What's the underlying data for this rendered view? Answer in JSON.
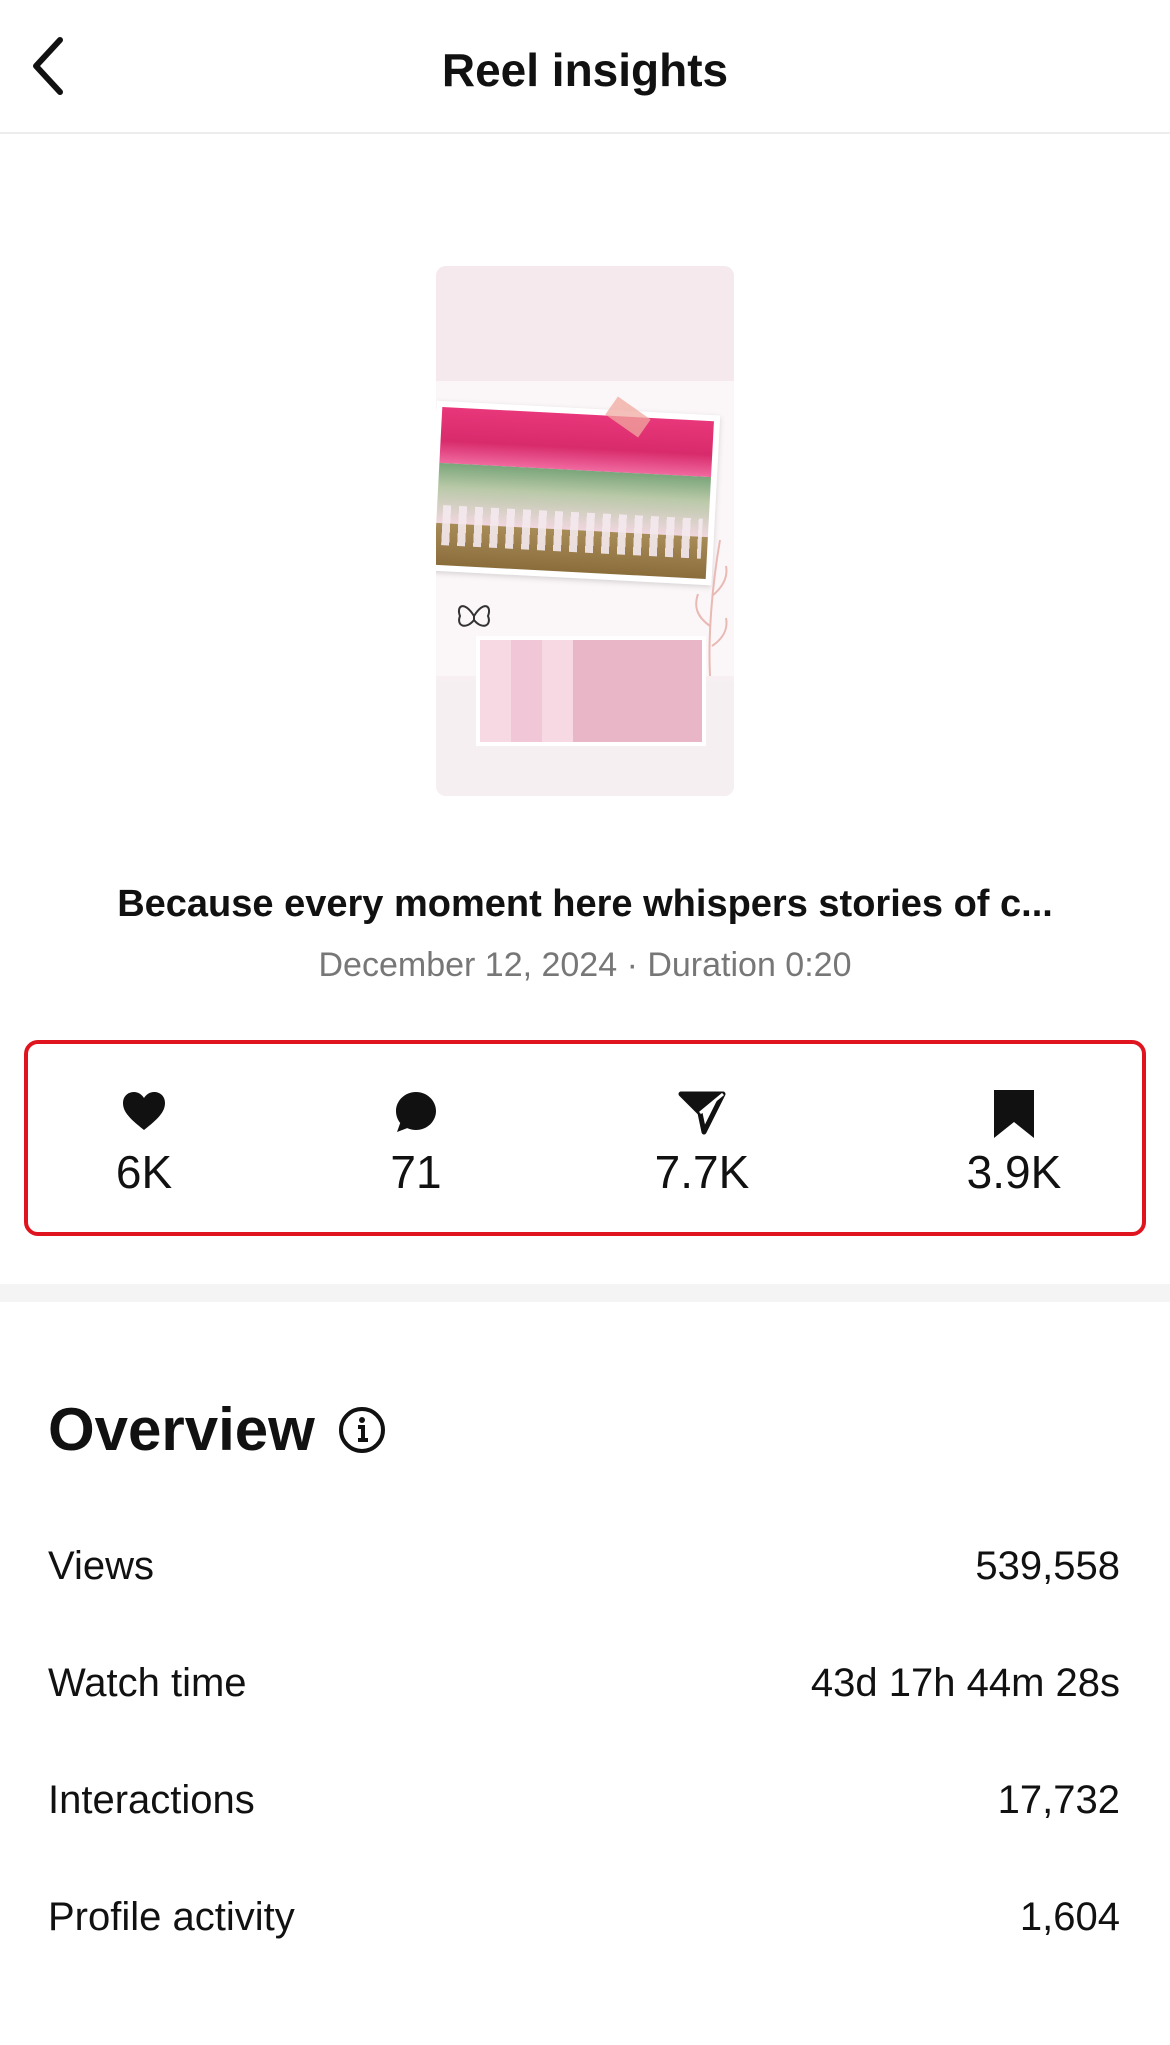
{
  "header": {
    "title": "Reel insights",
    "back_icon": "chevron-left-icon"
  },
  "reel": {
    "caption": "Because every moment here whispers stories of c...",
    "meta": "December 12, 2024 · Duration 0:20"
  },
  "stats": [
    {
      "icon": "heart-icon",
      "value": "6K"
    },
    {
      "icon": "comment-icon",
      "value": "71"
    },
    {
      "icon": "send-icon",
      "value": "7.7K"
    },
    {
      "icon": "bookmark-icon",
      "value": "3.9K"
    }
  ],
  "highlight_color": "#e0141e",
  "overview": {
    "title": "Overview",
    "info_icon": "info-icon",
    "rows": [
      {
        "label": "Views",
        "value": "539,558"
      },
      {
        "label": "Watch time",
        "value": "43d 17h 44m 28s"
      },
      {
        "label": "Interactions",
        "value": "17,732"
      },
      {
        "label": "Profile activity",
        "value": "1,604"
      }
    ]
  }
}
